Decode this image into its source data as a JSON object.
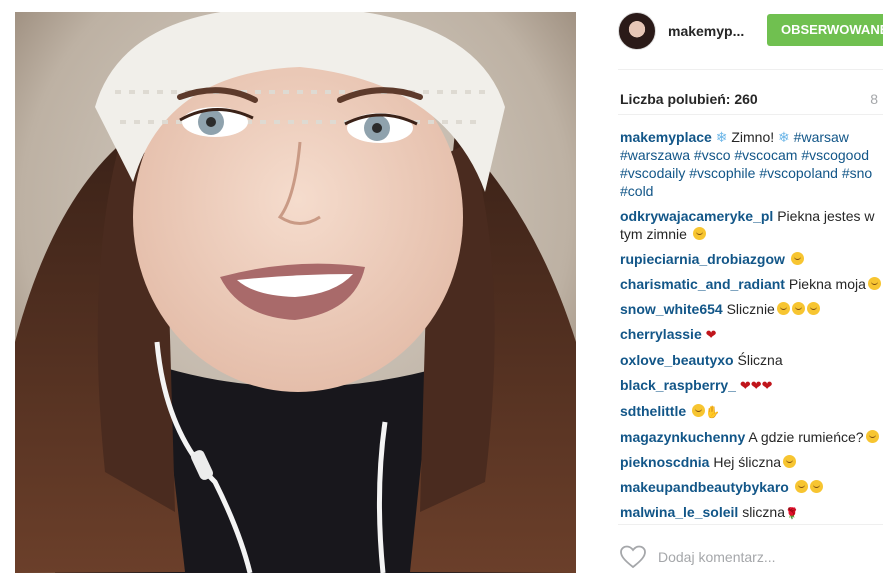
{
  "header": {
    "username": "makemyp...",
    "follow_label": "OBSERWOWANE"
  },
  "likes": {
    "label": "Liczba polubień: 260",
    "time_ago": "8"
  },
  "caption": {
    "user": "makemyplace",
    "text": "Zimno!",
    "lines": [
      [
        "#warsaw"
      ],
      [
        "#warszawa",
        "#vsco",
        "#vscocam",
        "#vscogood"
      ],
      [
        "#vscodaily",
        "#vscophile",
        "#vscopoland",
        "#sno"
      ],
      [
        "#cold"
      ]
    ]
  },
  "comments": [
    {
      "user": "odkrywajacameryke_pl",
      "text": "Piekna jestes w",
      "text2": "tym zimnie",
      "emojis": [
        "smile"
      ]
    },
    {
      "user": "rupieciarnia_drobiazgow",
      "text": "",
      "emojis": [
        "smile"
      ]
    },
    {
      "user": "charismatic_and_radiant",
      "text": "Piekna moja",
      "emojis": [
        "smile"
      ]
    },
    {
      "user": "snow_white654",
      "text": "Slicznie",
      "emojis": [
        "smile",
        "smile",
        "smile"
      ]
    },
    {
      "user": "cherrylassie",
      "text": "",
      "emojis": [
        "heart"
      ]
    },
    {
      "user": "oxlove_beautyxo",
      "text": "Śliczna",
      "emojis": []
    },
    {
      "user": "black_raspberry_",
      "text": "",
      "emojis": [
        "heart",
        "heart",
        "heart"
      ]
    },
    {
      "user": "sdthelittle",
      "text": "",
      "emojis": [
        "smile",
        "hand"
      ]
    },
    {
      "user": "magazynkuchenny",
      "text": "A gdzie rumieńce?",
      "emojis": [
        "smile"
      ]
    },
    {
      "user": "pieknoscdnia",
      "text": "Hej ślicznа",
      "emojis": [
        "smile"
      ]
    },
    {
      "user": "makeupandbeautybykaro",
      "text": "",
      "emojis": [
        "smile",
        "smile"
      ]
    },
    {
      "user": "malwina_le_soleil",
      "text": "sliczna",
      "emojis": [
        "rose"
      ]
    }
  ],
  "footer": {
    "comment_placeholder": "Dodaj komentarz..."
  },
  "colors": {
    "accent_link": "#125688",
    "follow_green": "#70c050",
    "muted": "#a5a7aa"
  }
}
